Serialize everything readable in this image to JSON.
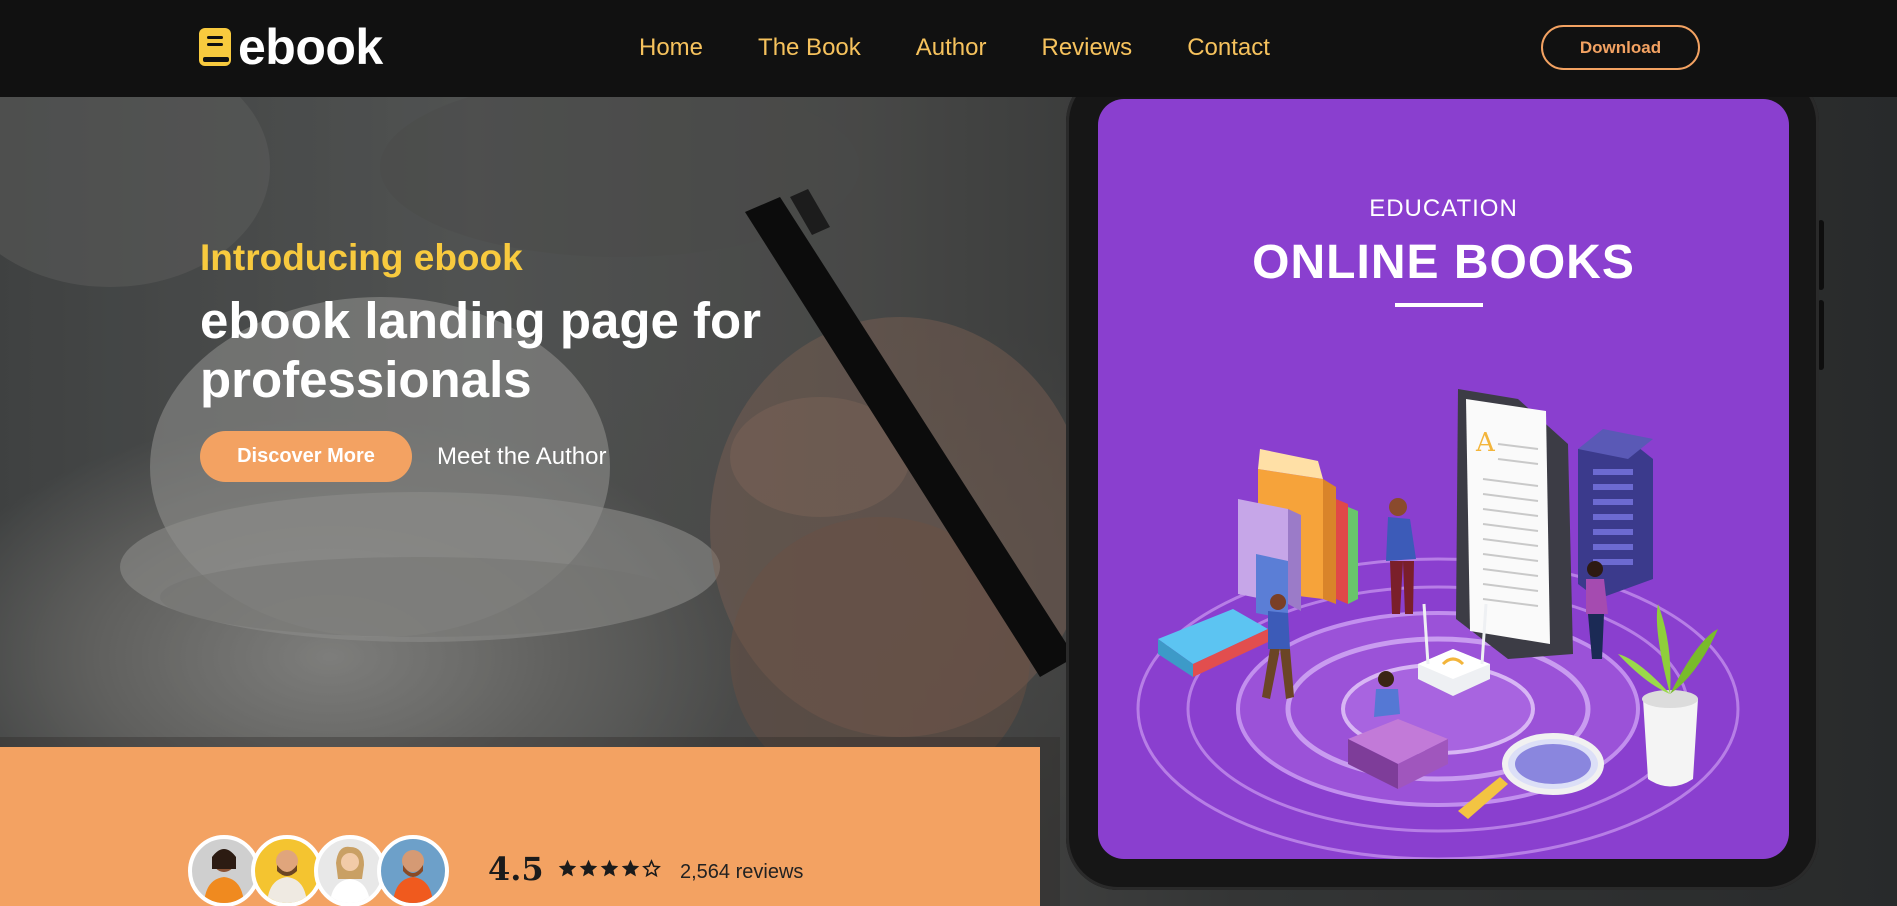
{
  "brand": {
    "name": "ebook",
    "accent": "#f3a262",
    "highlight": "#f8ca3e",
    "nav_link_color": "#f6c25d",
    "logo_icon": "book-icon"
  },
  "nav": {
    "links": [
      "Home",
      "The Book",
      "Author",
      "Reviews",
      "Contact"
    ],
    "cta": "Download"
  },
  "hero": {
    "eyebrow": "Introducing ebook",
    "headline": "ebook landing page for professionals",
    "primary_cta": "Discover More",
    "secondary_cta": "Meet the Author"
  },
  "book_cover": {
    "kicker": "EDUCATION",
    "title": "ONLINE BOOKS",
    "background": "#8a3fcf",
    "screen_letter": "A"
  },
  "social_proof": {
    "rating": "4.5",
    "stars_filled": 4,
    "stars_total": 5,
    "reviews_text": "2,564 reviews",
    "avatar_count": 4
  }
}
